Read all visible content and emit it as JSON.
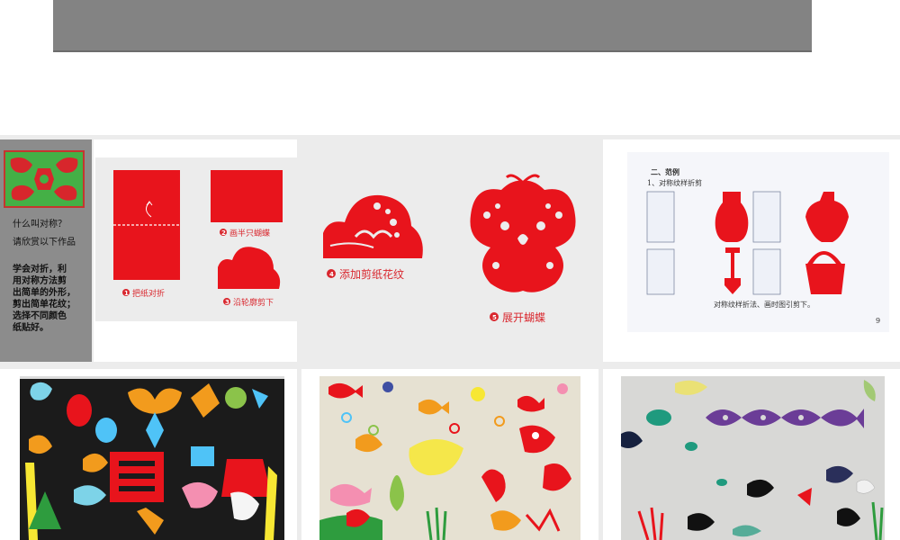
{
  "slide": {
    "intro": {
      "question": "什么叫对称？",
      "prompt": "请欣赏以下作品",
      "description": "学会对折，利\n用对称方法剪\n出简单的外形，\n剪出简单花纹；\n选择不同颜色\n纸贴好。"
    },
    "steps": [
      {
        "number": "1",
        "caption": "把纸对折"
      },
      {
        "number": "2",
        "caption": "画半只蝴蝶"
      },
      {
        "number": "3",
        "caption": "沿轮廓剪下"
      },
      {
        "number": "4",
        "caption": "添加剪纸花纹"
      },
      {
        "number": "5",
        "caption": "展开蝴蝶"
      }
    ],
    "examples": {
      "heading": "二、范例",
      "subheading": "1、对称纹样折剪",
      "footnote": "对称纹样折法、画时图引剪下。",
      "page_number": "9"
    }
  },
  "colors": {
    "title_bar": "#838383",
    "paper_red": "#e8141c",
    "side_panel": "#8c8c8c",
    "photo_black_board": "#1b1b1b"
  }
}
